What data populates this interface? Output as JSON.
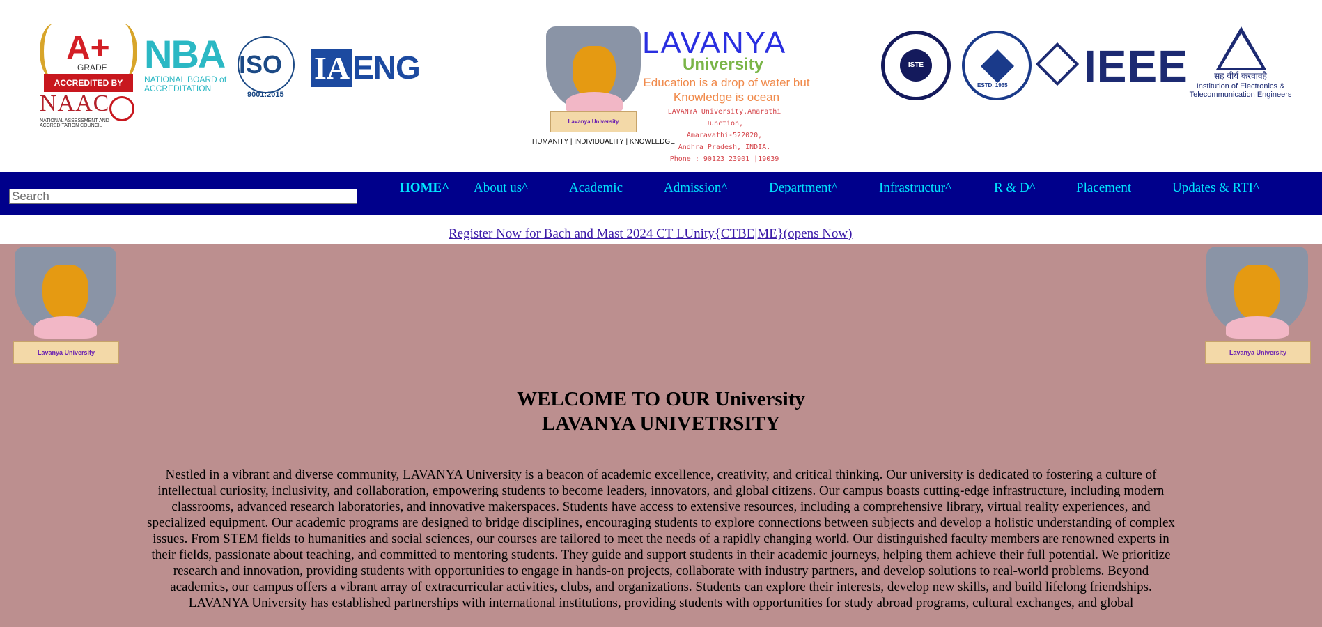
{
  "header": {
    "naac": {
      "grade_mark": "A+",
      "grade_label": "GRADE",
      "ribbon": "ACCREDITED BY",
      "name": "NAAC",
      "full_name": "NATIONAL ASSESSMENT AND ACCREDITATION COUNCIL"
    },
    "nba": {
      "name": "NBA",
      "full_name": "NATIONAL BOARD of ACCREDITATION"
    },
    "iso": {
      "name": "ISO",
      "number": "9001:2015"
    },
    "iaeng": {
      "part1": "IA",
      "part2": "ENG"
    },
    "university": {
      "name": "LAVANYA",
      "sub": "University",
      "motto": "Education is a drop of water but Knowledge is ocean",
      "address": [
        "LAVANYA University,Amarathi Junction,",
        "Amaravathi-522020,",
        "Andhra Pradesh, INDIA.",
        "Phone : 90123 23901 |19039"
      ],
      "tagline": "HUMANITY | INDIVIDUALITY | KNOWLEDGE",
      "scroll_text": "Lavanya University"
    },
    "iste": {
      "name": "ISTE"
    },
    "csi": {
      "estd": "ESTD. 1965"
    },
    "ieee": {
      "name": "IEEE"
    },
    "iete": {
      "hindi": "सह वीर्यं करवावहै",
      "name": "Institution of Electronics & Telecommunication Engineers"
    }
  },
  "nav": {
    "search_placeholder": "Search",
    "items": [
      "HOME^",
      "About us^",
      "Academic",
      "Admission^",
      "Department^",
      "Infrastructur^",
      "R & D^",
      "Placement",
      "Updates & RTI^"
    ]
  },
  "register": {
    "link_text": "Register Now for Bach and Mast 2024 CT LUnity{CTBE|ME}(opens Now)"
  },
  "main": {
    "side_scroll_text": "Lavanya University",
    "welcome_line1": "WELCOME TO OUR University",
    "welcome_line2": "LAVANYA UNIVETRSITY",
    "about_p1": "Nestled in a vibrant and diverse community, LAVANYA University is a beacon of academic excellence, creativity, and critical thinking. Our university is dedicated to fostering a culture of intellectual curiosity, inclusivity, and collaboration, empowering students to become leaders, innovators, and global citizens. Our campus boasts cutting-edge infrastructure, including modern classrooms, advanced research laboratories, and innovative makerspaces. Students have access to extensive resources, including a comprehensive library, virtual reality experiences, and specialized equipment. Our academic programs are designed to bridge disciplines, encouraging students to explore connections between subjects and develop a holistic understanding of complex issues. From STEM fields to humanities and social sciences, our courses are tailored to meet the needs of a rapidly changing world. Our distinguished faculty members are renowned experts in their fields, passionate about teaching, and committed to mentoring students. They guide and support students in their academic journeys, helping them achieve their full potential. We prioritize research and innovation, providing students with opportunities to engage in hands-on projects, collaborate with industry partners, and develop solutions to real-world problems. Beyond academics, our campus offers a vibrant array of extracurricular activities, clubs, and organizations. Students can explore their interests, develop new skills, and build lifelong friendships.",
    "about_p2": "LAVANYA University has established partnerships with international institutions, providing students with opportunities for study abroad programs, cultural exchanges, and global"
  },
  "colors": {
    "nav_bg": "#00008b",
    "nav_text": "#00e5ff",
    "main_bg": "#bc8f8f",
    "link": "#3b1aa8"
  }
}
